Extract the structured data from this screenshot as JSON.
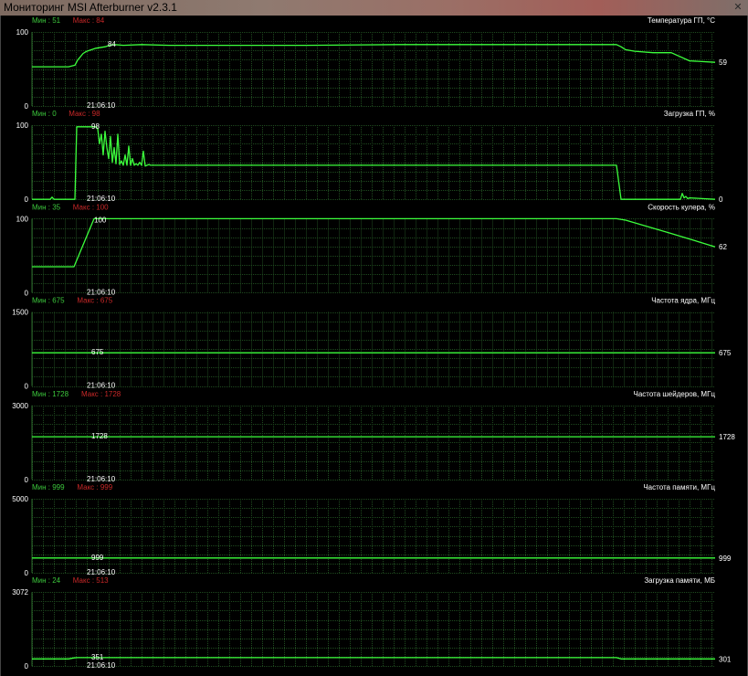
{
  "window": {
    "title": "Мониторинг MSI Afterburner v2.3.1",
    "close_label": "✕"
  },
  "colors": {
    "background": "#000000",
    "grid": "#1f4a1f",
    "line": "#3cff3c",
    "min_text": "#3cc83c",
    "max_text": "#c82828",
    "label_text": "#ffffff"
  },
  "time_label": "21:06:10",
  "chart_data": [
    {
      "type": "line",
      "title": "Температура ГП, °C",
      "min_label": "Мин : 51",
      "max_label": "Макс : 84",
      "ylim": [
        0,
        100
      ],
      "y_max_label": "100",
      "y_min_label": "0",
      "peak_label": "84",
      "current_label": "59",
      "x": [
        0,
        40,
        47,
        50,
        56,
        60,
        70,
        80,
        85,
        90,
        100,
        120,
        150,
        200,
        300,
        400,
        500,
        600,
        640,
        645,
        650,
        660,
        680,
        700,
        720,
        748
      ],
      "y": [
        53,
        53,
        55,
        62,
        71,
        74,
        78,
        80,
        82,
        83,
        82,
        83,
        82,
        82,
        82,
        83,
        83,
        83,
        83,
        80,
        76,
        74,
        72,
        72,
        61,
        59
      ]
    },
    {
      "type": "line",
      "title": "Загрузка ГП, %",
      "min_label": "Мин : 0",
      "max_label": "Макс : 98",
      "ylim": [
        0,
        100
      ],
      "y_max_label": "100",
      "y_min_label": "0",
      "peak_label": "98",
      "current_label": "0",
      "x": [
        0,
        20,
        22,
        24,
        40,
        47,
        49,
        70,
        72,
        74,
        76,
        78,
        80,
        82,
        84,
        86,
        88,
        90,
        92,
        94,
        96,
        98,
        100,
        102,
        104,
        106,
        108,
        110,
        112,
        114,
        116,
        118,
        120,
        122,
        124,
        126,
        128,
        130,
        640,
        645,
        650,
        700,
        710,
        712,
        714,
        716,
        718,
        720,
        748
      ],
      "y": [
        0,
        0,
        3,
        0,
        0,
        0,
        98,
        98,
        95,
        75,
        88,
        60,
        92,
        70,
        55,
        85,
        50,
        70,
        48,
        88,
        47,
        52,
        46,
        60,
        46,
        72,
        46,
        55,
        46,
        48,
        46,
        50,
        46,
        65,
        45,
        46,
        47,
        46,
        46,
        0,
        0,
        0,
        0,
        8,
        2,
        4,
        1,
        2,
        0
      ]
    },
    {
      "type": "line",
      "title": "Скорость кулера, %",
      "min_label": "Мин : 35",
      "max_label": "Макс : 100",
      "ylim": [
        0,
        100
      ],
      "y_max_label": "100",
      "y_min_label": "0",
      "peak_label": "100",
      "current_label": "62",
      "x": [
        0,
        46,
        68,
        70,
        640,
        650,
        700,
        748
      ],
      "y": [
        35,
        35,
        100,
        100,
        100,
        98,
        80,
        62
      ]
    },
    {
      "type": "line",
      "title": "Частота ядра, МГц",
      "min_label": "Мин : 675",
      "max_label": "Макс : 675",
      "ylim": [
        0,
        1500
      ],
      "y_max_label": "1500",
      "y_min_label": "0",
      "peak_label": "675",
      "current_label": "675",
      "x": [
        0,
        748
      ],
      "y": [
        675,
        675
      ]
    },
    {
      "type": "line",
      "title": "Частота шейдеров, МГц",
      "min_label": "Мин : 1728",
      "max_label": "Макс : 1728",
      "ylim": [
        0,
        3000
      ],
      "y_max_label": "3000",
      "y_min_label": "0",
      "peak_label": "1728",
      "current_label": "1728",
      "x": [
        0,
        748
      ],
      "y": [
        1728,
        1728
      ]
    },
    {
      "type": "line",
      "title": "Частота памяти, МГц",
      "min_label": "Мин : 999",
      "max_label": "Макс : 999",
      "ylim": [
        0,
        5000
      ],
      "y_max_label": "5000",
      "y_min_label": "0",
      "peak_label": "999",
      "current_label": "999",
      "x": [
        0,
        748
      ],
      "y": [
        999,
        999
      ]
    },
    {
      "type": "line",
      "title": "Загрузка памяти, МБ",
      "min_label": "Мин : 24",
      "max_label": "Макс : 513",
      "ylim": [
        0,
        3072
      ],
      "y_max_label": "3072",
      "y_min_label": "0",
      "peak_label": "351",
      "current_label": "301",
      "x": [
        0,
        40,
        46,
        50,
        640,
        645,
        748
      ],
      "y": [
        300,
        300,
        340,
        351,
        351,
        301,
        301
      ]
    }
  ]
}
